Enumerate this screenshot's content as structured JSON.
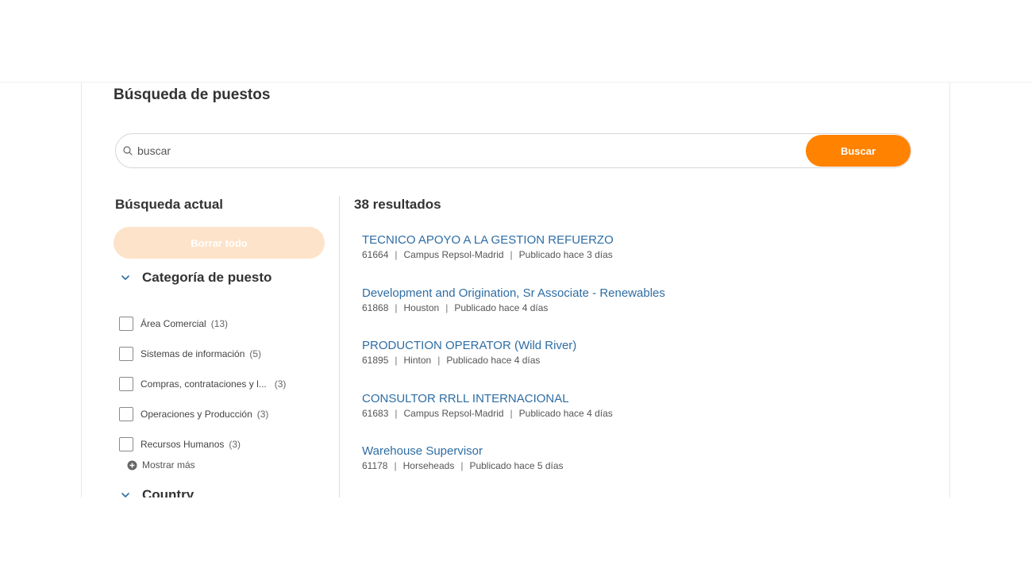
{
  "page": {
    "title": "Búsqueda de puestos"
  },
  "search": {
    "placeholder": "buscar",
    "value": "",
    "button_label": "Buscar"
  },
  "sidebar": {
    "current_title": "Búsqueda actual",
    "clear_label": "Borrar todo",
    "facets": [
      {
        "title": "Categoría de puesto",
        "items": [
          {
            "label": "Área Comercial",
            "count": "(13)"
          },
          {
            "label": "Sistemas de información",
            "count": "(5)"
          },
          {
            "label": "Compras, contrataciones y l...",
            "count": "(3)"
          },
          {
            "label": "Operaciones y Producción",
            "count": "(3)"
          },
          {
            "label": "Recursos Humanos",
            "count": "(3)"
          }
        ],
        "show_more": "Mostrar más"
      },
      {
        "title": "Country"
      }
    ]
  },
  "results": {
    "count_label": "38 resultados",
    "jobs": [
      {
        "title": "TECNICO APOYO A LA GESTION REFUERZO",
        "id": "61664",
        "location": "Campus Repsol-Madrid",
        "posted": "Publicado hace 3 días"
      },
      {
        "title": "Development and Origination, Sr Associate - Renewables",
        "id": "61868",
        "location": "Houston",
        "posted": "Publicado hace 4 días"
      },
      {
        "title": "PRODUCTION OPERATOR (Wild River)",
        "id": "61895",
        "location": "Hinton",
        "posted": "Publicado hace 4 días"
      },
      {
        "title": "CONSULTOR RRLL INTERNACIONAL",
        "id": "61683",
        "location": "Campus Repsol-Madrid",
        "posted": "Publicado hace 4 días"
      },
      {
        "title": "Warehouse Supervisor",
        "id": "61178",
        "location": "Horseheads",
        "posted": "Publicado hace 5 días"
      }
    ]
  },
  "colors": {
    "accent": "#ff8200",
    "accent_light": "#fde3c9",
    "link": "#2e6da4"
  },
  "icons": {
    "search": "search-icon",
    "chevron": "chevron-down-icon",
    "show_more": "plus-circle-icon"
  }
}
